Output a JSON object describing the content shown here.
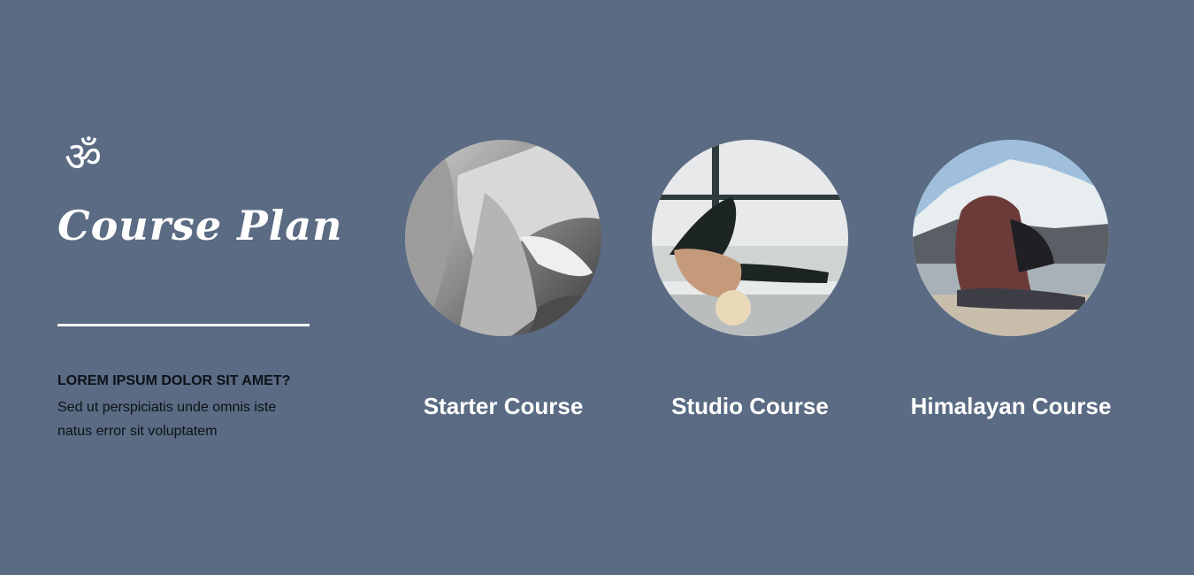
{
  "section": {
    "icon": "om-icon",
    "om_glyph": "ॐ",
    "title": "Course Plan",
    "question": "LOREM IPSUM DOLOR SIT AMET?",
    "body": "Sed ut perspiciatis unde omnis iste natus error sit voluptatem"
  },
  "courses": [
    {
      "label": "Starter Course",
      "image": "yoga-pose-bw-photo"
    },
    {
      "label": "Studio Course",
      "image": "studio-yoga-pose-photo"
    },
    {
      "label": "Himalayan Course",
      "image": "mountain-yoga-pose-photo"
    }
  ],
  "colors": {
    "background": "#5a6b83",
    "text_light": "#ffffff",
    "text_dark": "#0d1118"
  }
}
